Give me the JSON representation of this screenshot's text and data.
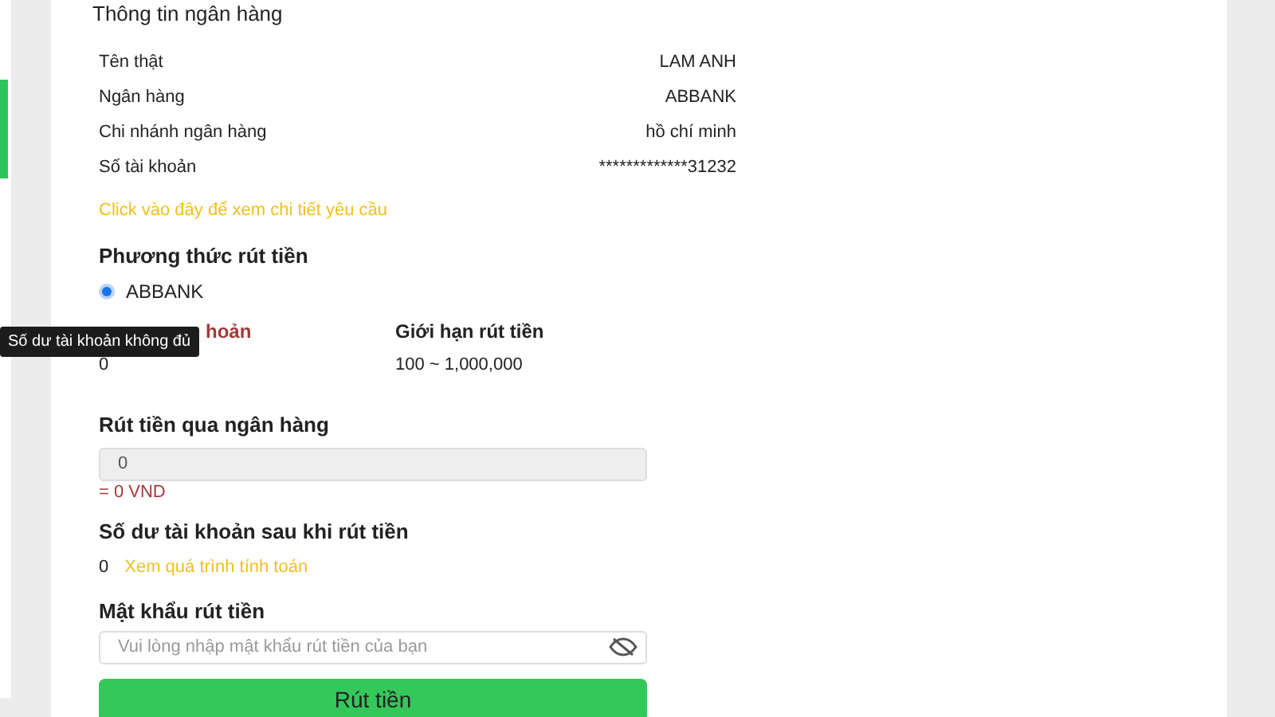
{
  "bank_info": {
    "title": "Thông tin ngân hàng",
    "rows": [
      {
        "label": "Tên thật",
        "value": "LAM ANH"
      },
      {
        "label": "Ngân hàng",
        "value": "ABBANK"
      },
      {
        "label": "Chi nhánh ngân hàng",
        "value": "hồ chí minh"
      },
      {
        "label": "Số tài khoản",
        "value": "*************31232"
      }
    ],
    "details_link": "Click vào đây để xem chi tiết yêu cầu"
  },
  "method": {
    "heading": "Phương thức rút tiền",
    "options": [
      {
        "label": "ABBANK",
        "selected": true
      }
    ]
  },
  "balance": {
    "label": "hoản",
    "value": "0",
    "tooltip": "Số dư tài khoản không đủ"
  },
  "limit": {
    "label": "Giới hạn rút tiền",
    "value": "100 ~ 1,000,000"
  },
  "amount": {
    "heading": "Rút tiền qua ngân hàng",
    "value": "0",
    "converted": "= 0 VND"
  },
  "after": {
    "heading": "Số dư tài khoản sau khi rút tiền",
    "value": "0",
    "link": "Xem quá trình tính toán"
  },
  "password": {
    "heading": "Mật khẩu rút tiền",
    "placeholder": "Vui lòng nhập mật khẩu rút tiền của bạn"
  },
  "submit": "Rút tiền"
}
